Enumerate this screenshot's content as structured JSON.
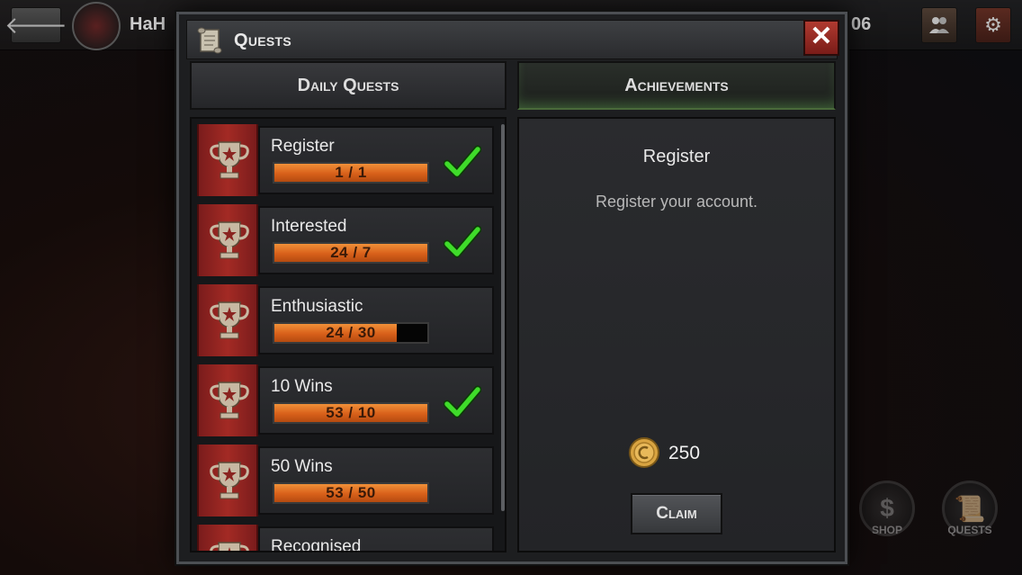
{
  "background": {
    "player_name": "HaH",
    "score_fragment": "06",
    "dock": [
      {
        "label": "SHOP",
        "icon": "money-bag-icon"
      },
      {
        "label": "QUESTS",
        "icon": "scroll-icon"
      }
    ]
  },
  "dialog": {
    "title": "Quests",
    "close_label": "✕",
    "tabs": [
      {
        "label": "Daily Quests",
        "active": false
      },
      {
        "label": "Achievements",
        "active": true
      }
    ],
    "quests": [
      {
        "name": "Register",
        "progress_text": "1 / 1",
        "progress_fraction": 1.0,
        "completed": true
      },
      {
        "name": "Interested",
        "progress_text": "24 / 7",
        "progress_fraction": 1.0,
        "completed": true
      },
      {
        "name": "Enthusiastic",
        "progress_text": "24 / 30",
        "progress_fraction": 0.8,
        "completed": false
      },
      {
        "name": "10 Wins",
        "progress_text": "53 / 10",
        "progress_fraction": 1.0,
        "completed": true
      },
      {
        "name": "50 Wins",
        "progress_text": "53 / 50",
        "progress_fraction": 1.0,
        "completed": false
      },
      {
        "name": "Recognised",
        "progress_text": "",
        "progress_fraction": 0,
        "completed": false
      }
    ],
    "detail": {
      "title": "Register",
      "description": "Register your account.",
      "reward_amount": "250",
      "claim_label": "Claim"
    }
  },
  "colors": {
    "progress_orange": "#d8601a",
    "check_green": "#3fdc2a",
    "ribbon_red": "#a32a24",
    "close_red": "#b03a30",
    "coin_gold": "#d9a441"
  }
}
